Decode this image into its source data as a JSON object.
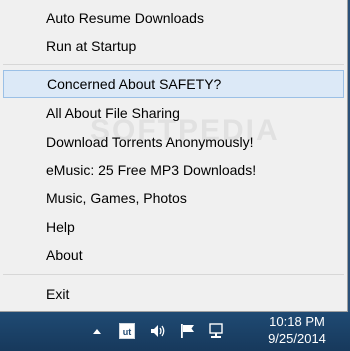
{
  "menu": {
    "items_top": [
      {
        "label": "Auto Resume Downloads"
      },
      {
        "label": "Run at Startup"
      }
    ],
    "items_main": [
      {
        "label": "Concerned About SAFETY?",
        "highlighted": true
      },
      {
        "label": "All About File Sharing"
      },
      {
        "label": "Download Torrents Anonymously!"
      },
      {
        "label": "eMusic: 25 Free MP3 Downloads!"
      },
      {
        "label": "Music, Games, Photos"
      },
      {
        "label": "Help"
      },
      {
        "label": "About"
      }
    ],
    "items_bottom": [
      {
        "label": "Exit"
      }
    ]
  },
  "taskbar": {
    "tray_icons": [
      "chevron-up-icon",
      "utorrent-icon",
      "volume-icon",
      "flag-icon",
      "network-icon"
    ],
    "clock": {
      "time": "10:18 PM",
      "date": "9/25/2014"
    }
  },
  "colors": {
    "menu_bg": "#f0f0f0",
    "highlight_bg": "#dce9f7",
    "highlight_border": "#9bc0e6",
    "taskbar_bg": "#1f4a73"
  }
}
